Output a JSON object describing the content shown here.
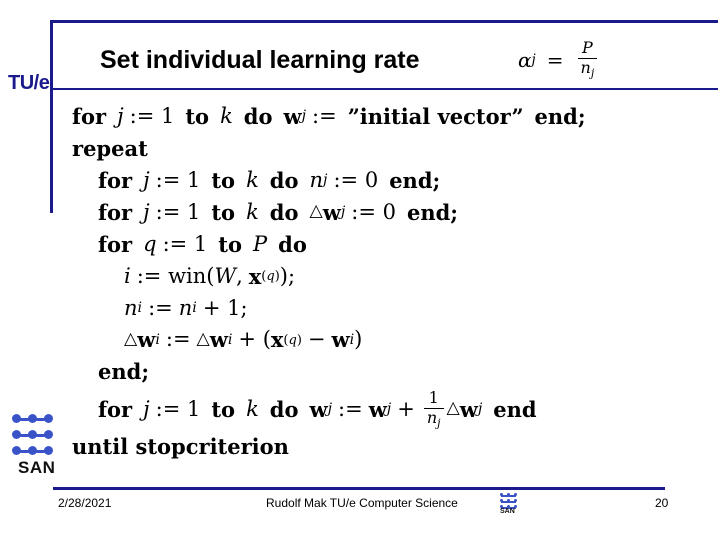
{
  "slide": {
    "title": "Set individual learning rate",
    "title_formula": {
      "lhs_symbol": "α",
      "lhs_sub": "j",
      "equals": "=",
      "numerator": "P",
      "denominator_symbol": "n",
      "denominator_sub": "j"
    },
    "logo_left": "TU/e",
    "logo_bottom": "SAN",
    "accent_color": "#1a1a8c",
    "logo_dot_color": "#3b53c9"
  },
  "algorithm": {
    "lines": [
      {
        "id": "line-1",
        "indent": 0,
        "tokens": [
          {
            "t": "kw",
            "v": "for"
          },
          {
            "t": "var",
            "v": "j"
          },
          {
            "t": "op",
            "v": ":= 1"
          },
          {
            "t": "kw",
            "v": "to"
          },
          {
            "t": "var",
            "v": "k"
          },
          {
            "t": "kw",
            "v": "do"
          },
          {
            "t": "vec",
            "v": "w"
          },
          {
            "t": "sub",
            "v": "j"
          },
          {
            "t": "op",
            "v": ":="
          },
          {
            "t": "str",
            "v": "”initial vector”"
          },
          {
            "t": "kw",
            "v": "end;"
          }
        ],
        "text": "for j := 1 to k do w_j := ”initial vector” end;"
      },
      {
        "id": "line-2",
        "indent": 0,
        "text": "repeat"
      },
      {
        "id": "line-3",
        "indent": 1,
        "text": "for j := 1 to k do n_j := 0 end;"
      },
      {
        "id": "line-4",
        "indent": 1,
        "text": "for j := 1 to k do △w_j := 0 end;"
      },
      {
        "id": "line-5",
        "indent": 1,
        "text": "for q := 1 to P do"
      },
      {
        "id": "line-6",
        "indent": 2,
        "text": "i := win(W, x^(q));"
      },
      {
        "id": "line-7",
        "indent": 2,
        "text": "n_i := n_i + 1;"
      },
      {
        "id": "line-8",
        "indent": 2,
        "text": "△w_i := △w_i + (x^(q) − w_i)"
      },
      {
        "id": "line-9",
        "indent": 1,
        "text": "end;"
      },
      {
        "id": "line-10",
        "indent": 1,
        "text": "for j := 1 to k do w_j := w_j + (1/n_j)△w_j end"
      },
      {
        "id": "line-11",
        "indent": 0,
        "text": "until stopcriterion"
      }
    ]
  },
  "footer": {
    "date": "2/28/2021",
    "center": "Rudolf Mak TU/e Computer Science",
    "page": "20"
  }
}
